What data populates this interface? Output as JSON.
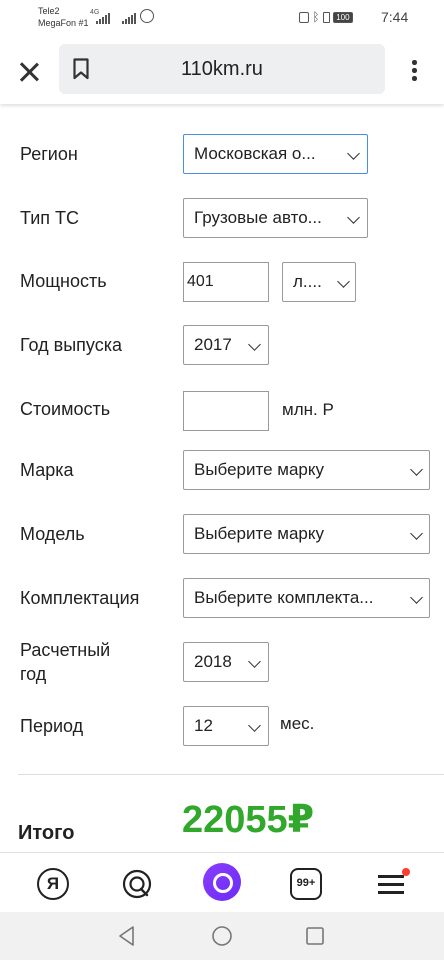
{
  "status_bar": {
    "carrier1": "Tele2",
    "carrier2": "MegaFon #1",
    "network": "4G",
    "battery": "100",
    "time": "7:44"
  },
  "browser": {
    "url": "110km.ru"
  },
  "form": {
    "region_label": "Регион",
    "region_value": "Московская о...",
    "vehicle_type_label": "Тип ТС",
    "vehicle_type_value": "Грузовые авто...",
    "power_label": "Мощность",
    "power_value": "401",
    "power_unit": "л....",
    "year_label": "Год выпуска",
    "year_value": "2017",
    "cost_label": "Стоимость",
    "cost_value": "",
    "cost_unit": "млн. Р",
    "brand_label": "Марка",
    "brand_value": "Выберите марку",
    "model_label": "Модель",
    "model_value": "Выберите марку",
    "trim_label": "Комплектация",
    "trim_value": "Выберите комплекта...",
    "calc_year_label_line1": "Расчетный",
    "calc_year_label_line2": "год",
    "calc_year_value": "2018",
    "period_label": "Период",
    "period_value": "12",
    "period_unit": "мес."
  },
  "result": {
    "total_label": "Итого",
    "total_value": "22055₽"
  },
  "bottom_nav": {
    "yandex_label": "Я",
    "tabs_count": "99+"
  },
  "colors": {
    "total": "#31a72c",
    "active_border": "#4a90e2",
    "alice": "#7b35f7",
    "notification": "#ff3b30"
  }
}
